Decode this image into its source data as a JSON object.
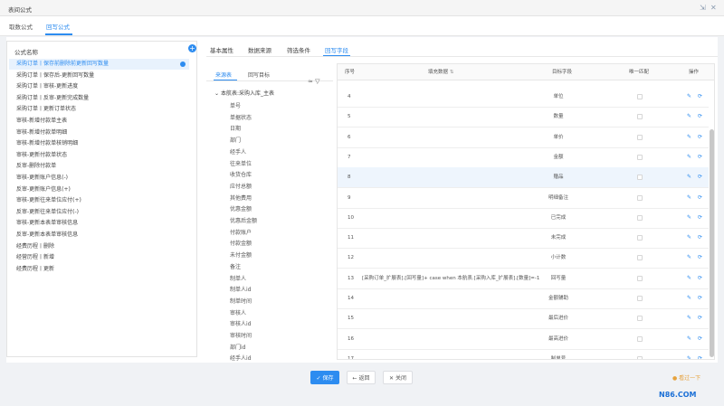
{
  "window": {
    "title": "表间公式",
    "controls": [
      "⇲",
      "✕"
    ]
  },
  "tabs": [
    {
      "label": "取数公式",
      "active": false
    },
    {
      "label": "回写公式",
      "active": true
    }
  ],
  "left_panel": {
    "header": "公式名称",
    "add_icon": "plus-circle-icon",
    "items": [
      "采购订单丨保存前删除前更新回写数量",
      "采购订单丨保存后-更新回写数量",
      "采购订单丨审核-更新进度",
      "采购订单丨反审-更新完成数量",
      "采购订单丨更新订单状态",
      "审核-新增付款单主表",
      "审核-新增付款单明细",
      "审核-新增付款单核销明细",
      "审核-更新付款单状态",
      "反审-删除付款单",
      "审核-更新账户信息(-)",
      "反审-更新账户信息(+)",
      "审核-更新往来单位应付(+)",
      "反审-更新往来单位应付(-)",
      "审核-更新本表单审核信息",
      "反审-更新本表单审核信息",
      "经费历程丨删除",
      "经营历程丨新增",
      "经费历程丨更新"
    ]
  },
  "right_tabs": [
    {
      "label": "基本属性",
      "active": false
    },
    {
      "label": "数据来源",
      "active": false
    },
    {
      "label": "筛选条件",
      "active": false
    },
    {
      "label": "回写字段",
      "active": true
    }
  ],
  "sub_tabs": [
    {
      "label": "来源表",
      "active": true
    },
    {
      "label": "回写目标",
      "active": false
    }
  ],
  "tree": {
    "root": "本航表:采购入库_主表",
    "nodes": [
      "单号",
      "单据状态",
      "日期",
      "部门",
      "经手人",
      "往来单位",
      "收货仓库",
      "应付总额",
      "其他费用",
      "优惠金额",
      "优惠后金额",
      "付款账户",
      "付款金额",
      "未付金额",
      "备注",
      "制单人",
      "制单人id",
      "制单时间",
      "审核人",
      "审核人id",
      "审核时间",
      "部门id",
      "经手人id"
    ]
  },
  "table": {
    "headers": {
      "no": "序号",
      "fill": "填充数据",
      "target": "目标字段",
      "unique": "唯一匹配",
      "ops": "操作"
    },
    "rows": [
      {
        "no": "4",
        "fill": "",
        "target": "单位"
      },
      {
        "no": "5",
        "fill": "",
        "target": "数量"
      },
      {
        "no": "6",
        "fill": "",
        "target": "单价"
      },
      {
        "no": "7",
        "fill": "",
        "target": "金额"
      },
      {
        "no": "8",
        "fill": "",
        "target": "赠品"
      },
      {
        "no": "9",
        "fill": "",
        "target": "明细备注"
      },
      {
        "no": "10",
        "fill": "",
        "target": "已完成"
      },
      {
        "no": "11",
        "fill": "",
        "target": "未完成"
      },
      {
        "no": "12",
        "fill": "",
        "target": "小计数"
      },
      {
        "no": "13",
        "fill": "[采购订单_扩展表].[回写量]+ case when 本航表.[采购入库_扩展表].[数量]=-1",
        "target": "回写量"
      },
      {
        "no": "14",
        "fill": "",
        "target": "金额辅助"
      },
      {
        "no": "15",
        "fill": "",
        "target": "最后进价"
      },
      {
        "no": "16",
        "fill": "",
        "target": "最高进价"
      },
      {
        "no": "17",
        "fill": "",
        "target": "制单号"
      }
    ],
    "highlight_row": 4
  },
  "buttons": {
    "save": "✓ 保存",
    "back": "← 返回",
    "close": "✕ 关闭"
  },
  "hint": "看过一下",
  "watermark": "N86.COM"
}
